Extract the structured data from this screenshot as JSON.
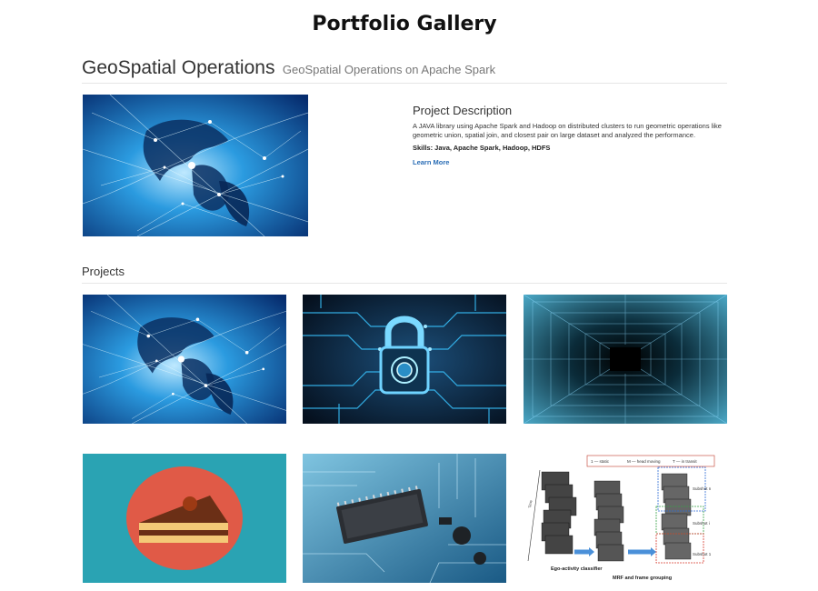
{
  "page": {
    "title": "Portfolio Gallery"
  },
  "featured": {
    "title": "GeoSpatial Operations",
    "subtitle": "GeoSpatial Operations on Apache Spark",
    "description_heading": "Project Description",
    "description": "A JAVA library using Apache Spark and Hadoop on distributed clusters to run geometric operations like geometric union, spatial join, and closest pair on large dataset and analyzed the performance.",
    "skills": "Skills: Java, Apache Spark, Hadoop, HDFS",
    "link_label": "Learn More"
  },
  "projects": {
    "heading": "Projects",
    "thumbnails": [
      {
        "icon": "globe-network-thumbnail"
      },
      {
        "icon": "digital-padlock-thumbnail"
      },
      {
        "icon": "data-tunnel-thumbnail"
      },
      {
        "icon": "cake-slice-thumbnail"
      },
      {
        "icon": "circuit-board-chip-thumbnail"
      },
      {
        "icon": "video-frames-diagram-thumbnail",
        "legend": [
          "1 — static",
          "M — head moving",
          "T — in transit"
        ],
        "labels": [
          "Ego-activity classifier",
          "MRF and frame grouping",
          "Subshot n",
          "Subshot i",
          "Subshot 1",
          "Time"
        ]
      }
    ]
  },
  "colors": {
    "accent_link": "#2a6db5",
    "cake_background": "#2aa3b3",
    "cake_plate": "#e05a47"
  }
}
